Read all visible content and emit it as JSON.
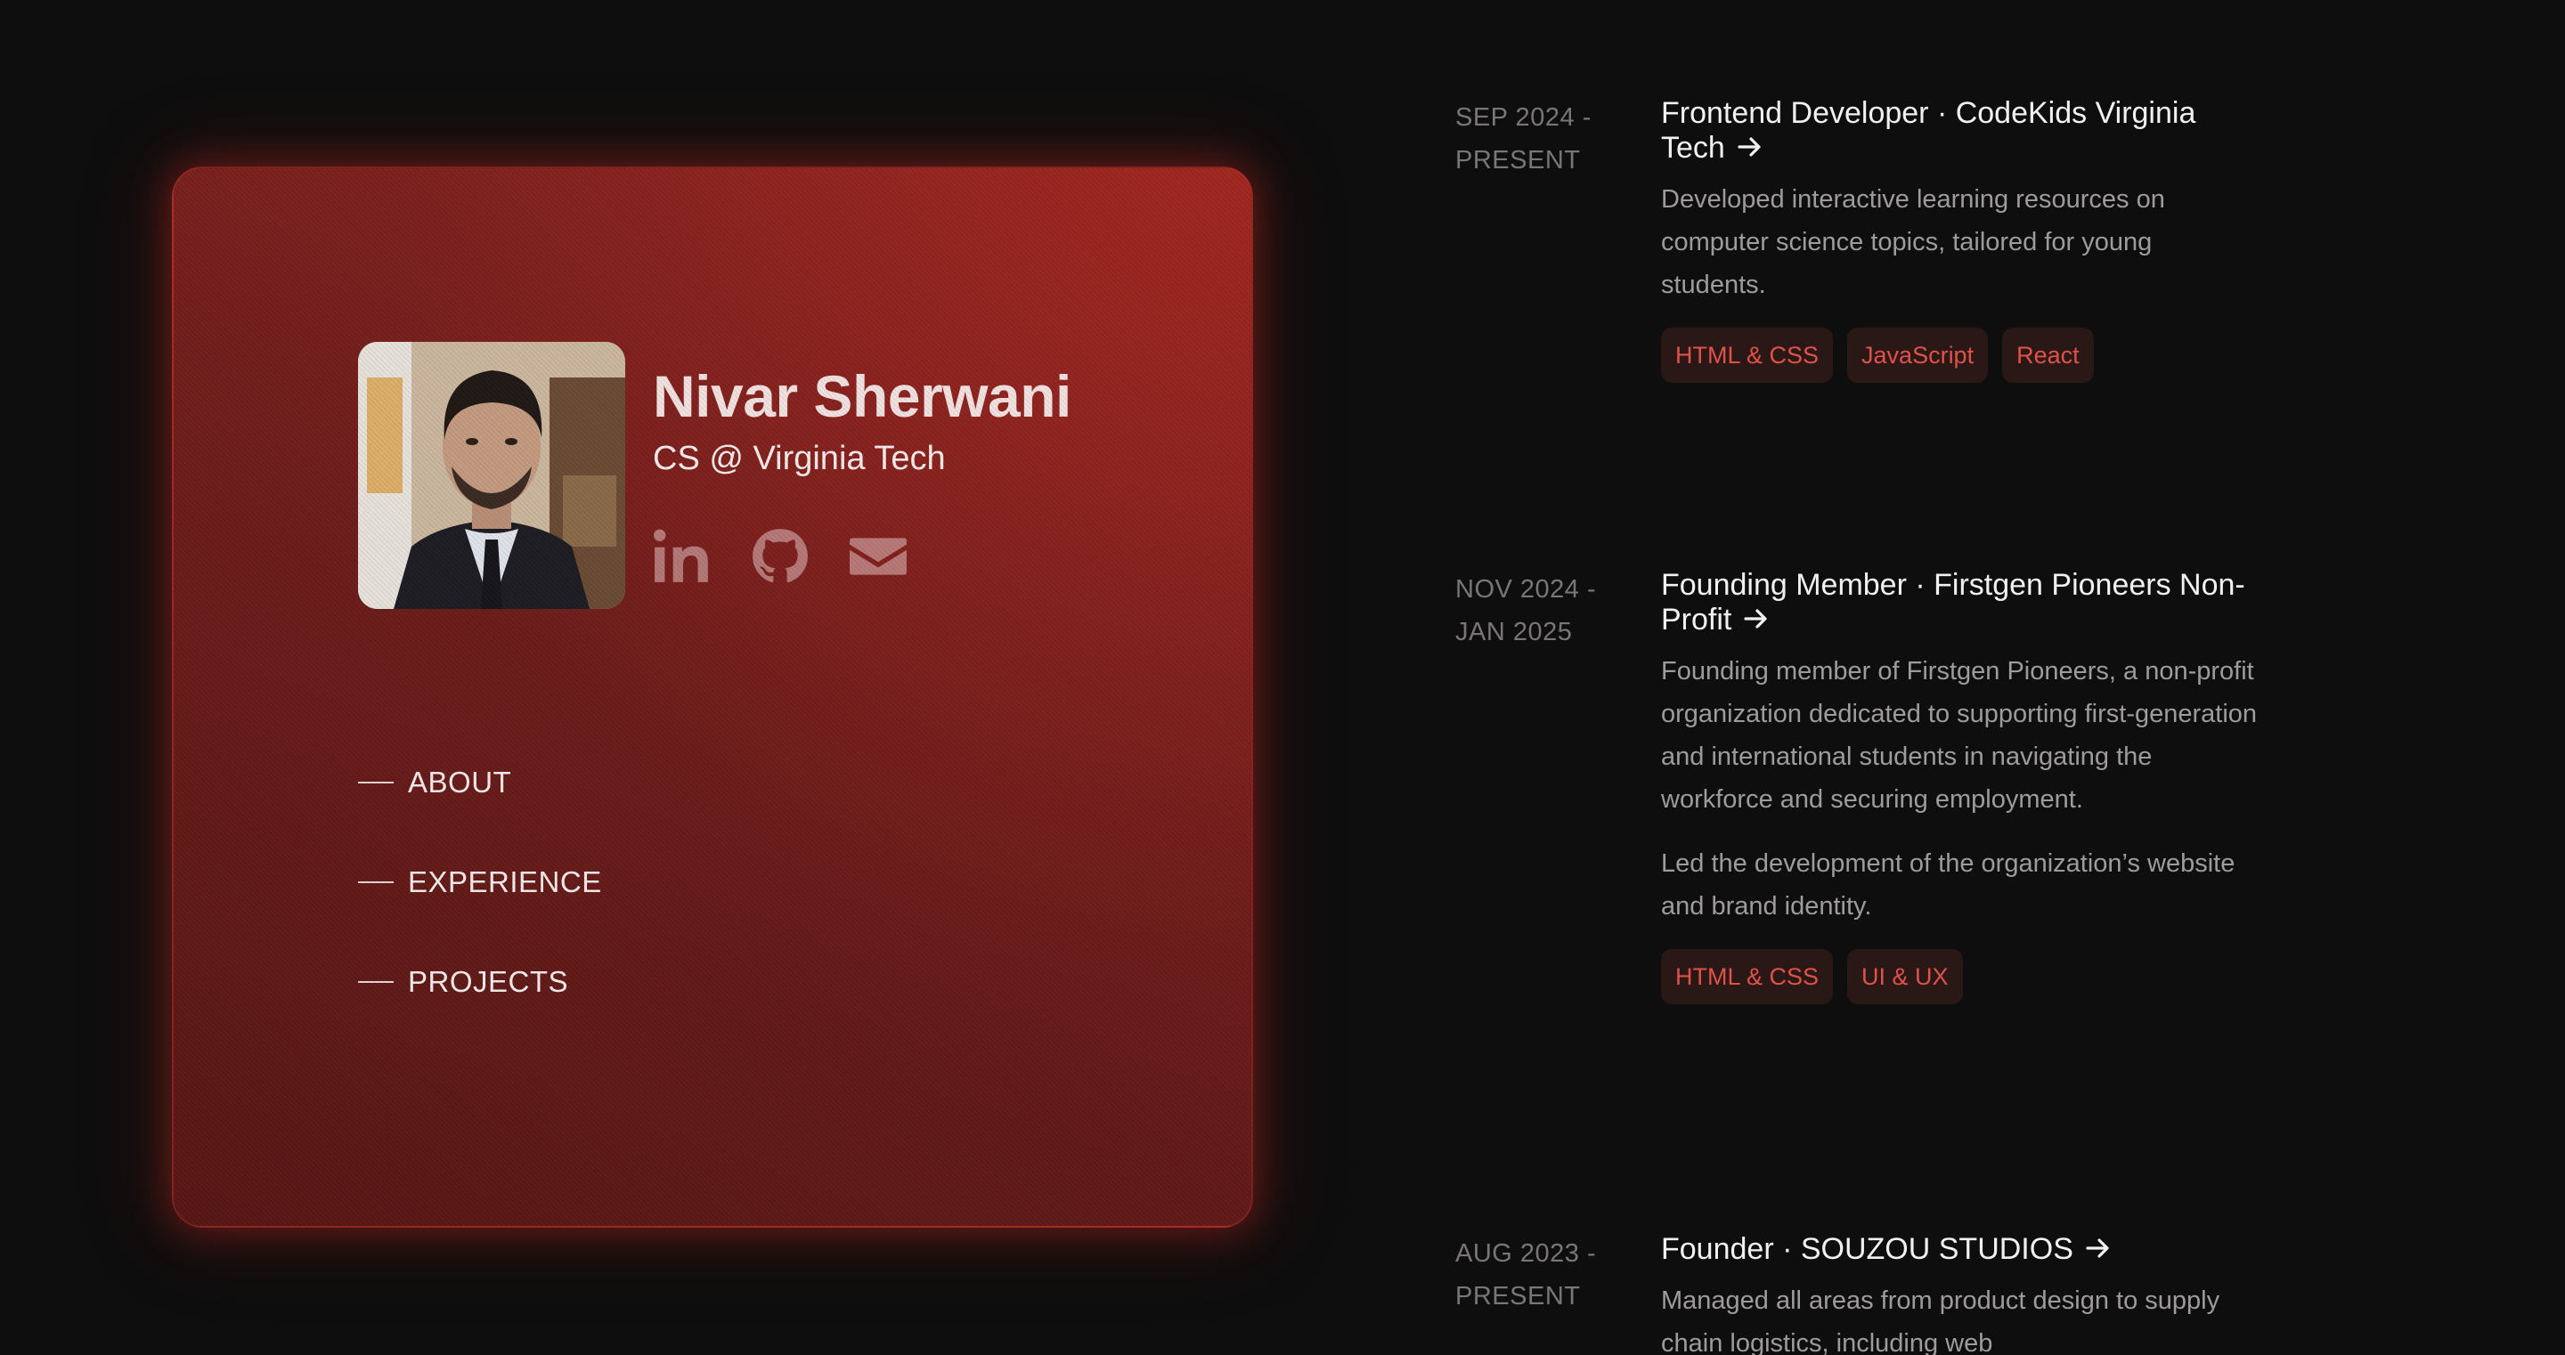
{
  "colors": {
    "page_background": "#0e0e0e",
    "card_red": "#7a201d",
    "tag_text": "#e0514a",
    "tag_background": "#2a1817"
  },
  "profile": {
    "name": "Nivar Sherwani",
    "tagline": "CS @ Virginia Tech",
    "socials": [
      {
        "icon": "linkedin-icon"
      },
      {
        "icon": "github-icon"
      },
      {
        "icon": "mail-icon"
      }
    ]
  },
  "nav": {
    "items": [
      {
        "label": "ABOUT"
      },
      {
        "label": "EXPERIENCE"
      },
      {
        "label": "PROJECTS"
      }
    ]
  },
  "experience": [
    {
      "date_start": "SEP 2024 -",
      "date_end": "PRESENT",
      "title": "Frontend Developer · CodeKids Virginia Tech",
      "paragraphs": [
        "Developed interactive learning resources on computer science topics, tailored for young students."
      ],
      "tags": [
        "HTML & CSS",
        "JavaScript",
        "React"
      ]
    },
    {
      "date_start": "NOV 2024 -",
      "date_end": "JAN 2025",
      "title": "Founding Member · Firstgen Pioneers Non-Profit",
      "paragraphs": [
        "Founding member of Firstgen Pioneers, a non-profit organization dedicated to supporting first-generation and international students in navigating the workforce and securing employment.",
        "Led the development of the organization’s website and brand identity."
      ],
      "tags": [
        "HTML & CSS",
        "UI & UX"
      ]
    },
    {
      "date_start": "AUG 2023 -",
      "date_end": "PRESENT",
      "title": "Founder · SOUZOU STUDIOS",
      "paragraphs": [
        "Managed all areas from product design to supply chain logistics, including web"
      ],
      "tags": []
    }
  ]
}
